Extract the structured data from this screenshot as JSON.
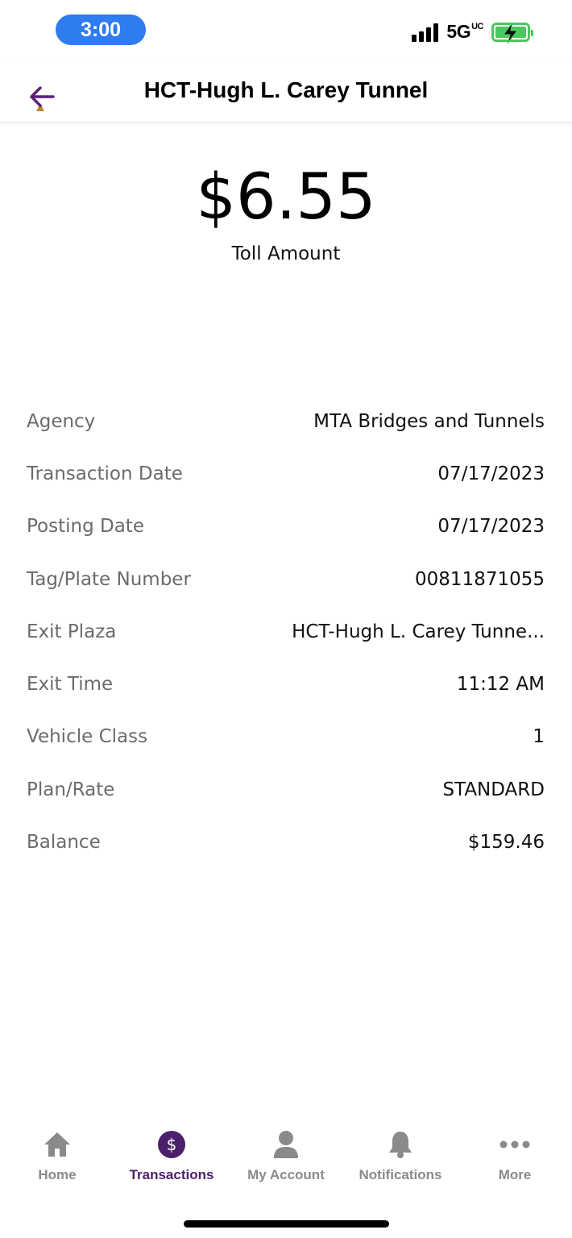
{
  "status_bar": {
    "time": "3:00",
    "network": "5G",
    "network_suffix": "UC",
    "colors": {
      "time_pill": "#2f7bf0",
      "battery": "#4cc75f"
    }
  },
  "nav": {
    "title": "HCT-Hugh L. Carey Tunnel",
    "back_icon": "arrow-left-icon",
    "accent_color": "#4b1f6b"
  },
  "summary": {
    "amount": "$6.55",
    "amount_label": "Toll Amount"
  },
  "details": [
    {
      "label": "Agency",
      "value": "MTA Bridges and Tunnels"
    },
    {
      "label": "Transaction Date",
      "value": "07/17/2023"
    },
    {
      "label": "Posting Date",
      "value": "07/17/2023"
    },
    {
      "label": "Tag/Plate Number",
      "value": "00811871055"
    },
    {
      "label": "Exit Plaza",
      "value": "HCT-Hugh L. Carey Tunne..."
    },
    {
      "label": "Exit Time",
      "value": "11:12 AM"
    },
    {
      "label": "Vehicle Class",
      "value": "1"
    },
    {
      "label": "Plan/Rate",
      "value": "STANDARD"
    },
    {
      "label": "Balance",
      "value": "$159.46"
    }
  ],
  "tab_bar": {
    "active": "Transactions",
    "items": [
      {
        "label": "Home",
        "icon": "home-icon"
      },
      {
        "label": "Transactions",
        "icon": "dollar-circle-icon"
      },
      {
        "label": "My Account",
        "icon": "person-icon"
      },
      {
        "label": "Notifications",
        "icon": "bell-icon"
      },
      {
        "label": "More",
        "icon": "more-dots-icon"
      }
    ]
  }
}
